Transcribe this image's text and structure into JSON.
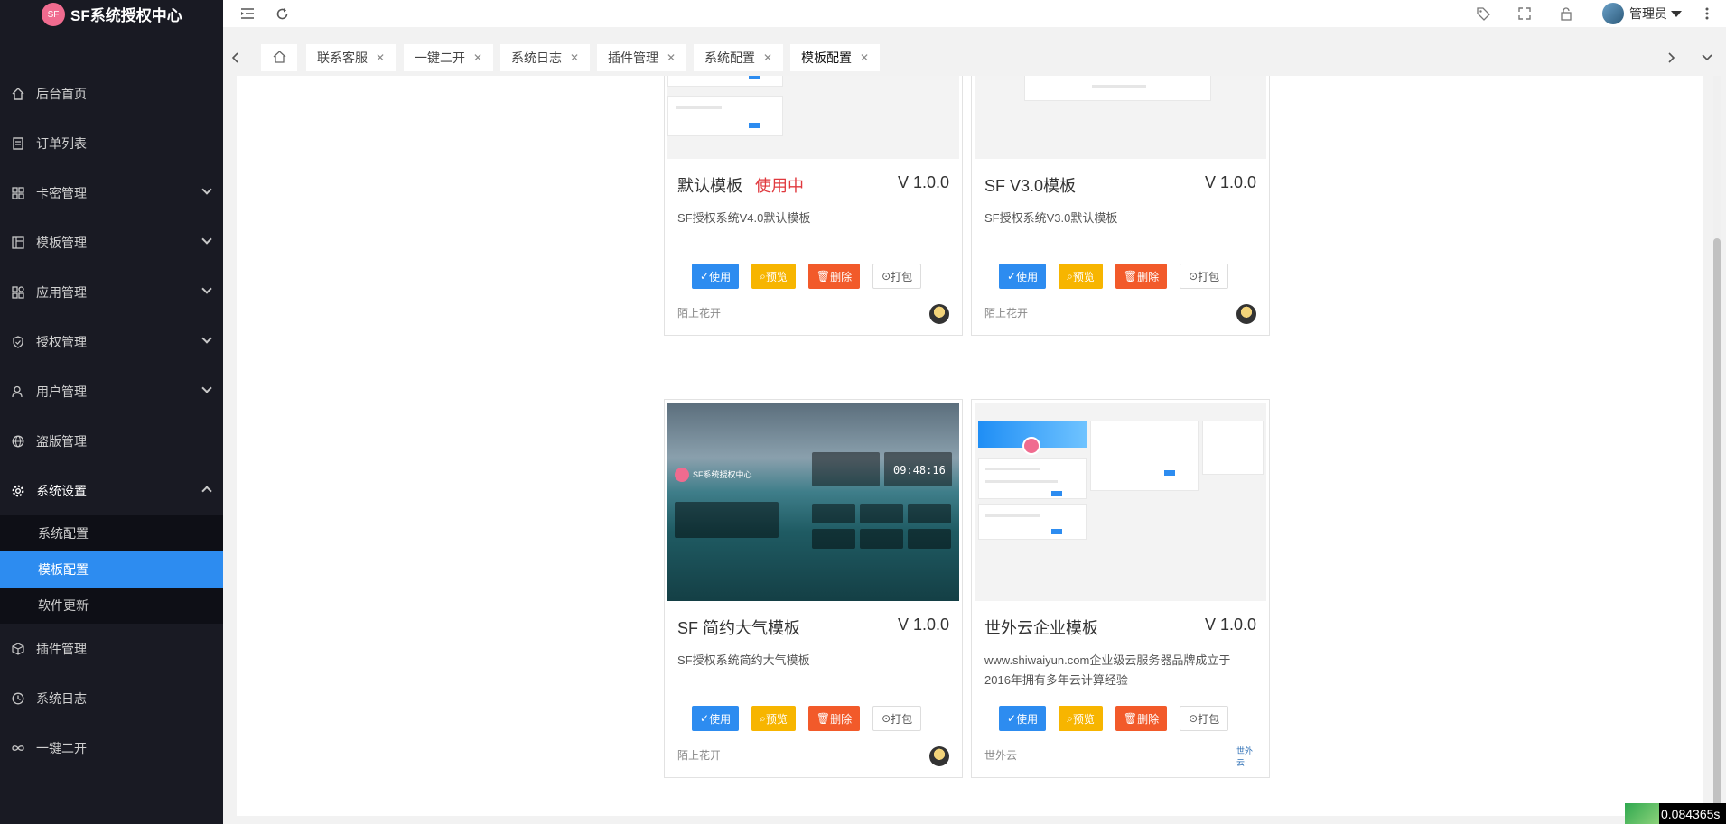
{
  "app": {
    "logo_mark": "SF",
    "title": "SF系统授权中心"
  },
  "sidebar": {
    "items": [
      {
        "label": "后台首页",
        "icon": "home-icon"
      },
      {
        "label": "订单列表",
        "icon": "document-icon"
      },
      {
        "label": "卡密管理",
        "icon": "grid-icon"
      },
      {
        "label": "模板管理",
        "icon": "layout-icon"
      },
      {
        "label": "应用管理",
        "icon": "apps-icon"
      },
      {
        "label": "授权管理",
        "icon": "shield-icon"
      },
      {
        "label": "用户管理",
        "icon": "user-icon"
      },
      {
        "label": "盗版管理",
        "icon": "globe-icon"
      },
      {
        "label": "系统设置",
        "icon": "gear-icon"
      },
      {
        "label": "插件管理",
        "icon": "cube-icon"
      },
      {
        "label": "系统日志",
        "icon": "clock-icon"
      },
      {
        "label": "一键二开",
        "icon": "infinity-icon"
      }
    ],
    "submenu": [
      "系统配置",
      "模板配置",
      "软件更新"
    ]
  },
  "header": {
    "user": "管理员"
  },
  "tabs": [
    "联系客服",
    "一键二开",
    "系统日志",
    "插件管理",
    "系统配置",
    "模板配置"
  ],
  "cards": [
    {
      "title": "默认模板",
      "status": "使用中",
      "version": "V 1.0.0",
      "desc": "SF授权系统V4.0默认模板",
      "author": "陌上花开"
    },
    {
      "title": "SF V3.0模板",
      "status": "",
      "version": "V 1.0.0",
      "desc": "SF授权系统V3.0默认模板",
      "author": "陌上花开"
    },
    {
      "title": "SF 简约大气模板",
      "status": "",
      "version": "V 1.0.0",
      "desc": "SF授权系统简约大气模板",
      "author": "陌上花开",
      "thumb_clock": "09:48:16",
      "thumb_brand": "SF系统授权中心"
    },
    {
      "title": "世外云企业模板",
      "status": "",
      "version": "V 1.0.0",
      "desc": "www.shiwaiyun.com企业级云服务器品牌成立于2016年拥有多年云计算经验",
      "author": "世外云",
      "author_logo": "世外云"
    }
  ],
  "buttons": {
    "use": "使用",
    "preview": "预览",
    "delete": "删除",
    "pack": "打包"
  },
  "timer": "0.084365s",
  "colors": {
    "sidebar_bg": "#191a23",
    "active": "#2d8cf0",
    "preview": "#f7b500",
    "delete": "#f25a2a",
    "status": "#e0393e"
  }
}
